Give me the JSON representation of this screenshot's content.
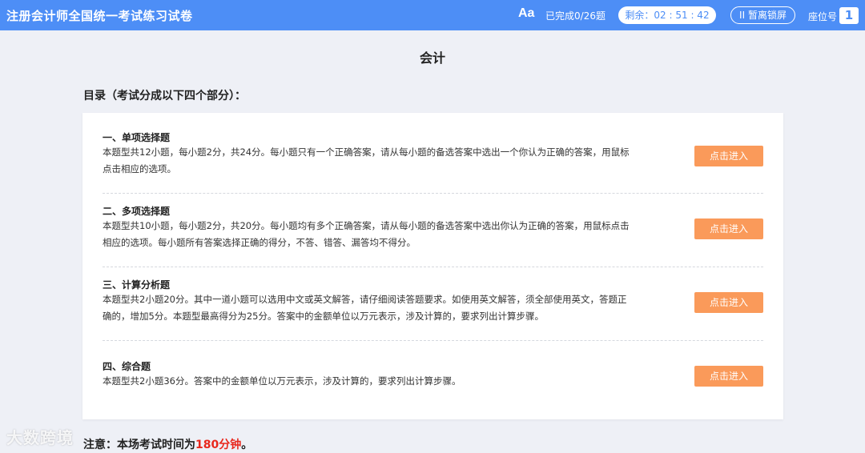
{
  "header": {
    "title": "注册会计师全国统一考试练习试卷",
    "font_size_icon": "Aa",
    "progress": "已完成0/26题",
    "timer": "剩余：02 : 51 : 42",
    "pause_label": "II 暂离锁屏",
    "seat_label": "座位号",
    "seat_number": "1"
  },
  "main": {
    "subject": "会计",
    "toc_heading": "目录（考试分成以下四个部分）：",
    "sections": [
      {
        "title": "一、单项选择题",
        "desc": "本题型共12小题，每小题2分，共24分。每小题只有一个正确答案，请从每小题的备选答案中选出一个你认为正确的答案，用鼠标点击相应的选项。",
        "button": "点击进入"
      },
      {
        "title": "二、多项选择题",
        "desc": "本题型共10小题，每小题2分，共20分。每小题均有多个正确答案，请从每小题的备选答案中选出你认为正确的答案，用鼠标点击相应的选项。每小题所有答案选择正确的得分，不答、错答、漏答均不得分。",
        "button": "点击进入"
      },
      {
        "title": "三、计算分析题",
        "desc": "本题型共2小题20分。其中一道小题可以选用中文或英文解答，请仔细阅读答题要求。如使用英文解答，须全部使用英文，答题正确的，增加5分。本题型最高得分为25分。答案中的金额单位以万元表示，涉及计算的，要求列出计算步骤。",
        "button": "点击进入"
      },
      {
        "title": "四、综合题",
        "desc": "本题型共2小题36分。答案中的金额单位以万元表示，涉及计算的，要求列出计算步骤。",
        "button": "点击进入"
      }
    ],
    "note_prefix": "注意：本场考试时间为",
    "note_highlight": "180分钟",
    "note_suffix": "。"
  },
  "watermark": "大数跨境",
  "colors": {
    "header_bg": "#4d8ef6",
    "button_bg": "#fa9a5a",
    "highlight": "#e8271c",
    "page_bg": "#eef0f6"
  }
}
